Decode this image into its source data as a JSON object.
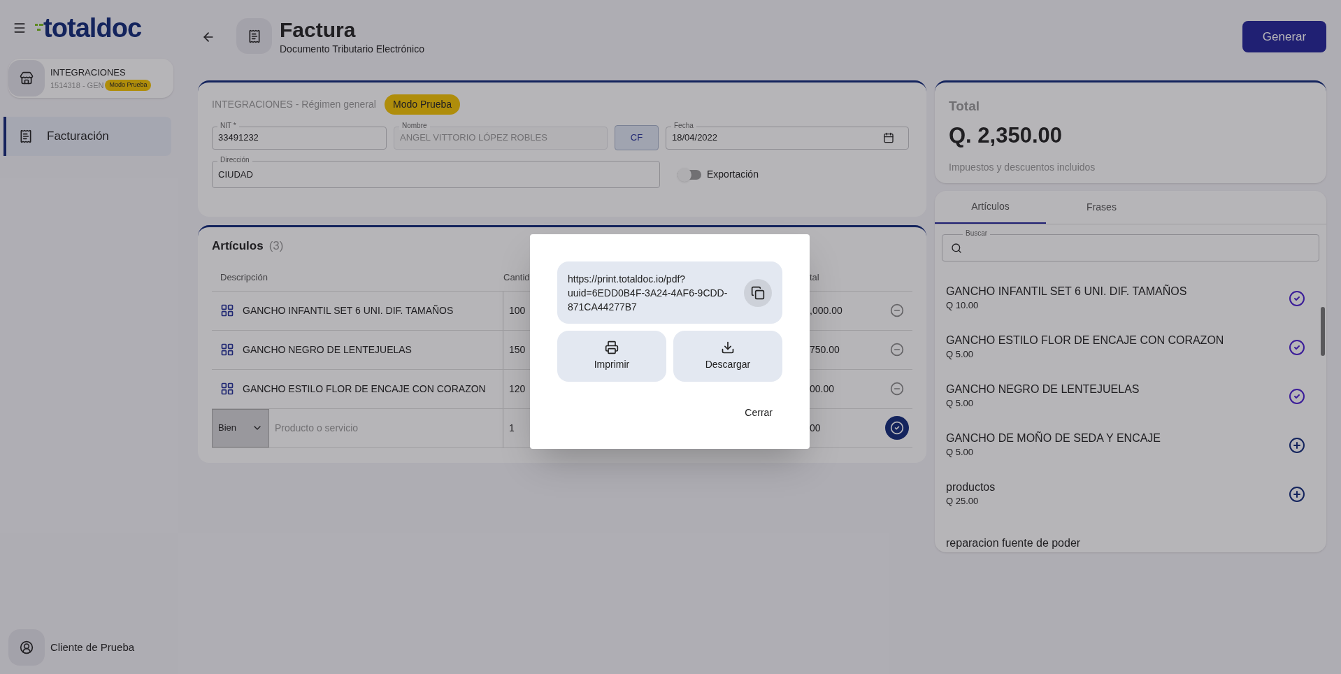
{
  "sidebar": {
    "logo": "totaldoc",
    "company": {
      "name": "INTEGRACIONES",
      "code": "1514318 - GEN",
      "badge": "Modo Prueba"
    },
    "items": [
      {
        "label": "Facturación",
        "selected": true
      }
    ],
    "user": "Cliente de Prueba"
  },
  "header": {
    "title": "Factura",
    "subtitle": "Documento Tributario Electrónico",
    "action": "Generar"
  },
  "form": {
    "company": "INTEGRACIONES - Régimen general",
    "badge": "Modo Prueba",
    "fields": [
      {
        "label": "NIT *",
        "value": "33491232",
        "disabled": false
      },
      {
        "label": "Nombre",
        "value": "ANGEL VITTORIO LÓPEZ ROBLES",
        "disabled": true
      }
    ],
    "cf_button": "CF",
    "date": {
      "label": "Fecha",
      "value": "18/04/2022"
    },
    "address": {
      "label": "Dirección",
      "value": "CIUDAD"
    },
    "export": {
      "label": "Exportación",
      "on": false
    }
  },
  "articles": {
    "title": "Artículos",
    "count": "(3)",
    "columns": [
      "Descripción",
      "Cantid",
      "tal"
    ],
    "rows": [
      {
        "description": "GANCHO INFANTIL SET 6 UNI. DIF. TAMAÑOS",
        "quantity": "100",
        "total": ",000.00"
      },
      {
        "description": "GANCHO NEGRO DE LENTEJUELAS",
        "quantity": "150",
        "total": "750.00"
      },
      {
        "description": "GANCHO ESTILO FLOR DE ENCAJE CON CORAZON",
        "quantity": "120",
        "total": "00.00"
      }
    ],
    "new_row": {
      "type": "Bien",
      "placeholder": "Producto o servicio",
      "quantity": "1",
      "total": "00"
    }
  },
  "summary": {
    "label": "Total",
    "amount": "Q. 2,350.00",
    "note": "Impuestos y descuentos incluidos"
  },
  "catalog": {
    "tabs": [
      {
        "label": "Artículos",
        "selected": true
      },
      {
        "label": "Frases",
        "selected": false
      }
    ],
    "search": {
      "label": "Buscar"
    },
    "items": [
      {
        "name": "GANCHO INFANTIL SET 6 UNI. DIF. TAMAÑOS",
        "price": "Q 10.00",
        "added": true
      },
      {
        "name": "GANCHO ESTILO FLOR DE ENCAJE CON CORAZON",
        "price": "Q 5.00",
        "added": true
      },
      {
        "name": "GANCHO NEGRO DE LENTEJUELAS",
        "price": "Q 5.00",
        "added": true
      },
      {
        "name": "GANCHO DE MOÑO DE SEDA Y ENCAJE",
        "price": "Q 5.00",
        "added": false
      },
      {
        "name": "productos",
        "price": "Q 25.00",
        "added": false
      },
      {
        "name": "reparacion fuente de poder"
      }
    ]
  },
  "dialog": {
    "url": "https://print.totaldoc.io/pdf?uuid=6EDD0B4F-3A24-4AF6-9CDD-871CA44277B7",
    "actions": [
      {
        "kind": "print",
        "label": "Imprimir"
      },
      {
        "kind": "download",
        "label": "Descargar"
      }
    ],
    "close": "Cerrar"
  }
}
